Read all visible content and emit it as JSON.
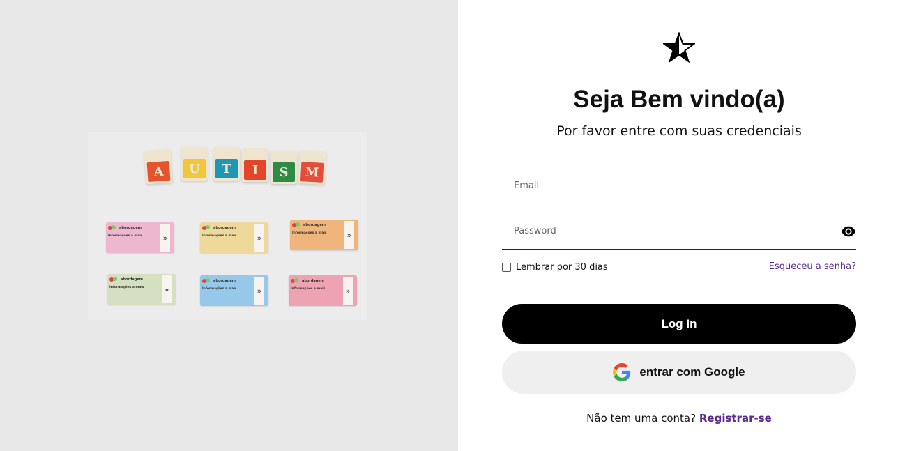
{
  "hero": {
    "blocks": [
      "A",
      "U",
      "T",
      "I",
      "S",
      "M"
    ],
    "cards": [
      {
        "brand": "abordagem",
        "info": "Informações a mais",
        "color": "#edb8cf"
      },
      {
        "brand": "abordagem",
        "info": "Informações a mais",
        "color": "#efd99a"
      },
      {
        "brand": "abordagem",
        "info": "Informações a mais",
        "color": "#efb57d"
      },
      {
        "brand": "abordagem",
        "info": "Informações a mais",
        "color": "#d4e0c0"
      },
      {
        "brand": "abordagem",
        "info": "Informações a mais",
        "color": "#96c8ea"
      },
      {
        "brand": "abordagem",
        "info": "Informações a mais",
        "color": "#eda3b2"
      }
    ]
  },
  "login": {
    "logo_icon": "star-icon",
    "title": "Seja Bem vindo(a)",
    "subtitle": "Por favor entre com suas credenciais",
    "email_placeholder": "Email",
    "password_placeholder": "Password",
    "password_toggle_icon": "eye-icon",
    "remember_label": "Lembrar por 30 dias",
    "forgot_link": "Esqueceu a senha?",
    "login_button": "Log In",
    "google_button": "entrar com Google",
    "google_icon": "google-icon",
    "register_prompt": "Não tem uma conta?",
    "register_link": "Registrar-se"
  },
  "colors": {
    "left_background": "#e8e8e8",
    "primary_button": "#000000",
    "link": "#5c2a91",
    "google_button_bg": "#efefef"
  }
}
